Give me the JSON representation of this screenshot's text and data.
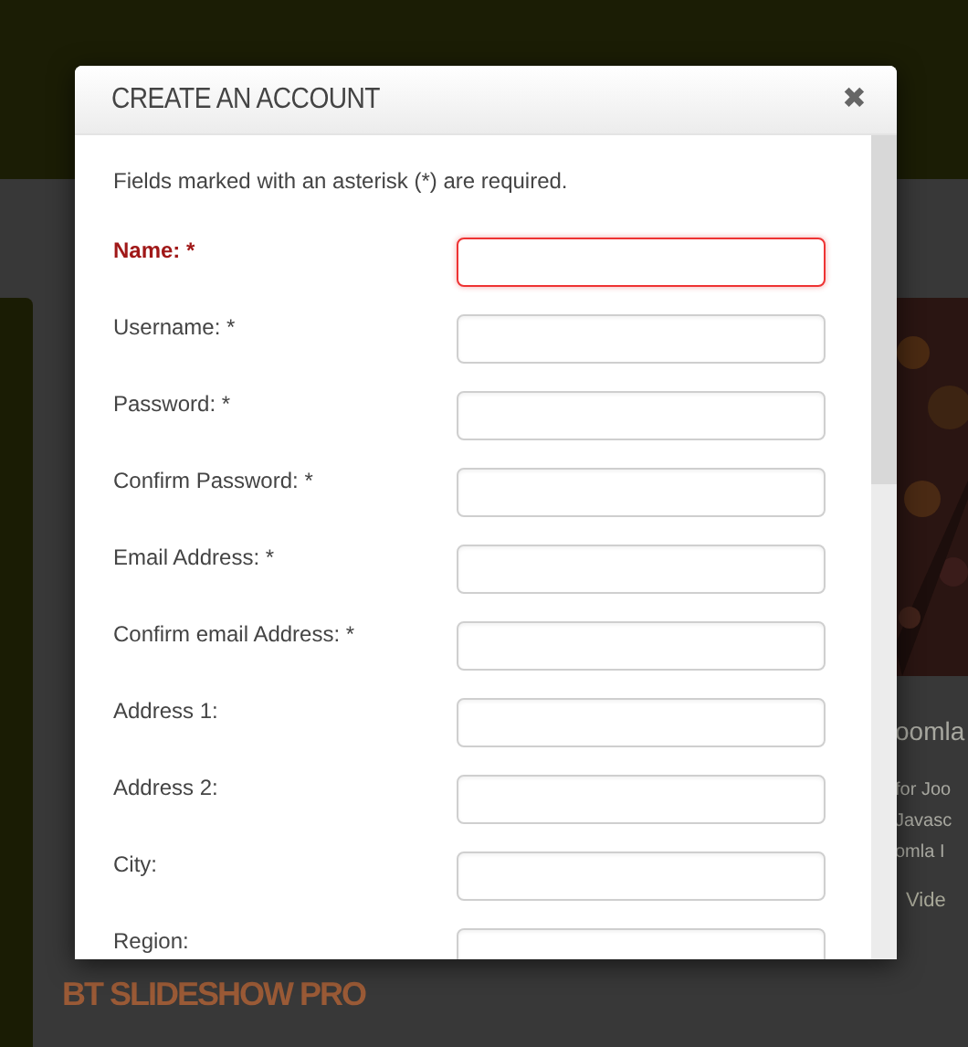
{
  "background": {
    "showcase": {
      "heading": "oomla",
      "lines": [
        "for Joo",
        "Javasc",
        "omla I"
      ],
      "link": "Vide"
    },
    "module_title": "BT SLIDESHOW PRO"
  },
  "dialog": {
    "title": "CREATE AN ACCOUNT",
    "close": "✖",
    "note": "Fields marked with an asterisk (*) are required.",
    "fields": [
      {
        "label": "Name: *",
        "invalid": true
      },
      {
        "label": "Username: *",
        "invalid": false
      },
      {
        "label": "Password: *",
        "invalid": false
      },
      {
        "label": "Confirm Password: *",
        "invalid": false
      },
      {
        "label": "Email Address: *",
        "invalid": false
      },
      {
        "label": "Confirm email Address: *",
        "invalid": false
      },
      {
        "label": "Address 1:",
        "invalid": false
      },
      {
        "label": "Address 2:",
        "invalid": false
      },
      {
        "label": "City:",
        "invalid": false
      },
      {
        "label": "Region:",
        "invalid": false
      }
    ]
  }
}
